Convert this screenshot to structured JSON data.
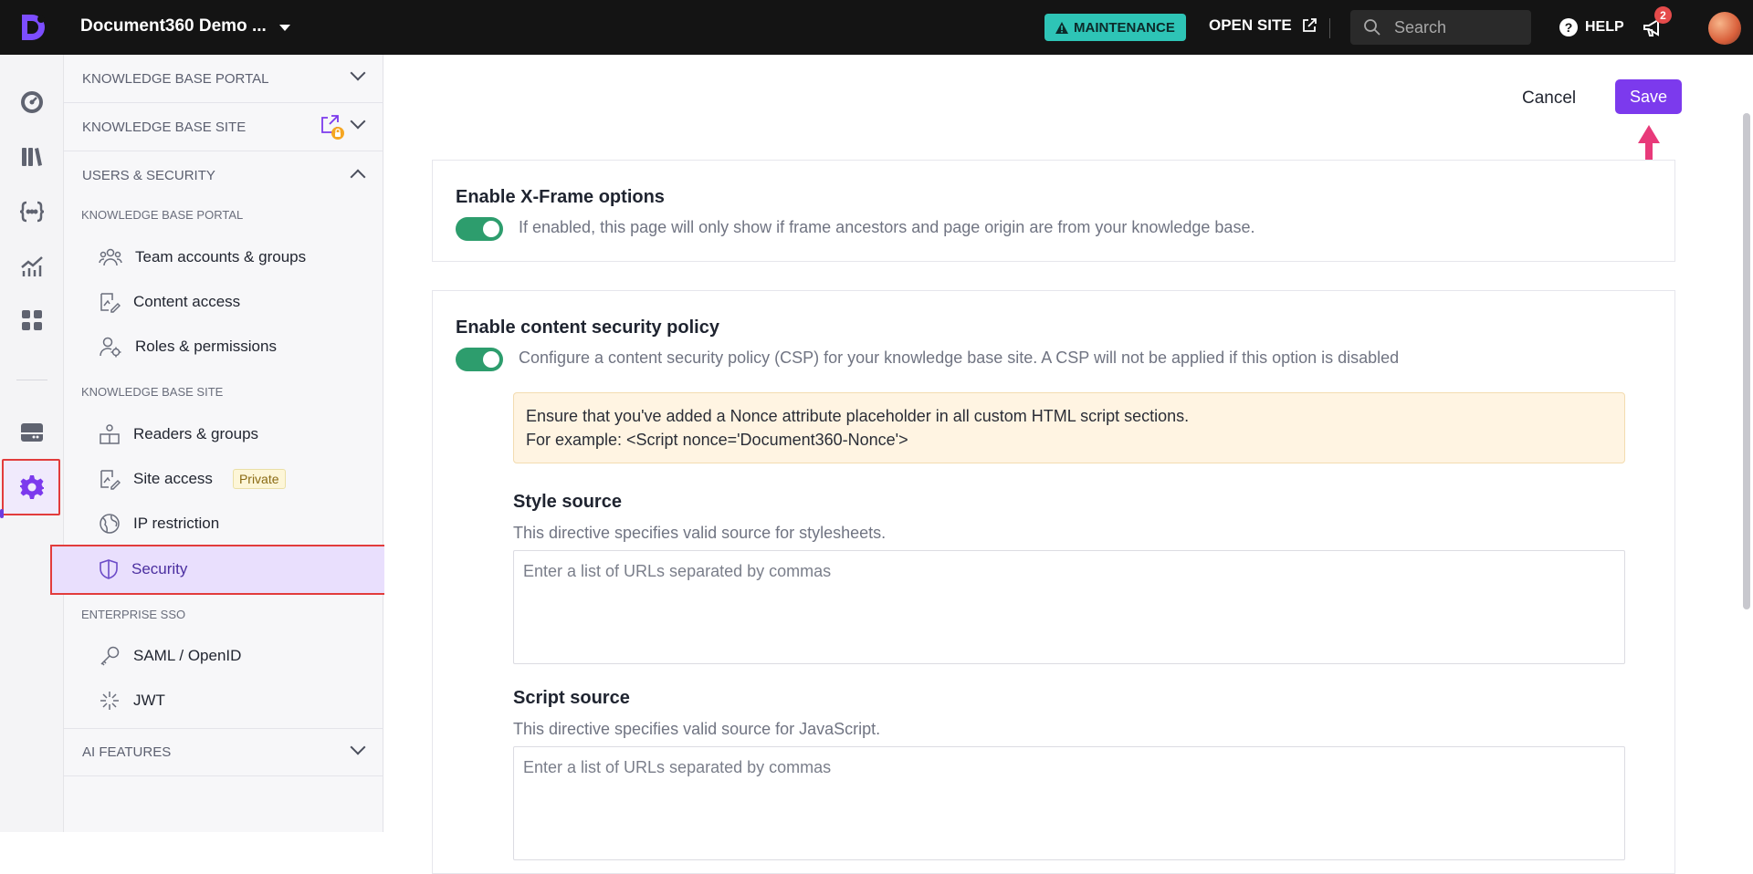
{
  "topbar": {
    "project_name": "Document360 Demo ...",
    "maintenance_label": "MAINTENANCE",
    "open_site_label": "OPEN SITE",
    "search_placeholder": "Search",
    "help_label": "HELP",
    "notification_count": "2",
    "colors": {
      "background": "#141414",
      "maintenance": "#2ec4b6"
    }
  },
  "rail": {
    "icons": [
      "dashboard-icon",
      "documents-icon",
      "api-icon",
      "analytics-icon",
      "apps-icon",
      "drive-icon",
      "settings-icon"
    ],
    "active": "settings-icon"
  },
  "nav": {
    "sections": {
      "kb_portal": "KNOWLEDGE BASE PORTAL",
      "kb_site": "KNOWLEDGE BASE SITE",
      "users_security": "USERS & SECURITY",
      "ai_features": "AI FEATURES"
    },
    "groups": {
      "portal": "KNOWLEDGE BASE PORTAL",
      "site": "KNOWLEDGE BASE SITE",
      "sso": "ENTERPRISE SSO"
    },
    "items": {
      "team": "Team accounts & groups",
      "content_access": "Content access",
      "roles": "Roles & permissions",
      "readers": "Readers & groups",
      "site_access": "Site access",
      "site_access_badge": "Private",
      "ip": "IP restriction",
      "security": "Security",
      "saml": "SAML / OpenID",
      "jwt": "JWT"
    },
    "active_item": "Security"
  },
  "main": {
    "cancel_label": "Cancel",
    "save_label": "Save",
    "xframe": {
      "title": "Enable X-Frame options",
      "description": "If enabled, this page will only show if frame ancestors and page origin are from your knowledge base.",
      "enabled": true
    },
    "csp": {
      "title": "Enable content security policy",
      "description": "Configure a content security policy (CSP) for your knowledge base site. A CSP will not be applied if this option is disabled",
      "enabled": true,
      "alert_line1": "Ensure that you've added a Nonce attribute placeholder in all custom HTML script sections.",
      "alert_line2": "For example: <Script nonce='Document360-Nonce'>",
      "style_source": {
        "title": "Style source",
        "description": "This directive specifies valid source for stylesheets.",
        "placeholder": "Enter a list of URLs separated by commas",
        "value": ""
      },
      "script_source": {
        "title": "Script source",
        "description": "This directive specifies valid source for JavaScript.",
        "placeholder": "Enter a list of URLs separated by commas",
        "value": ""
      }
    },
    "colors": {
      "accent": "#7c3aed",
      "toggle_on": "#2d9d6d",
      "annotation": "#e83a7a"
    }
  }
}
